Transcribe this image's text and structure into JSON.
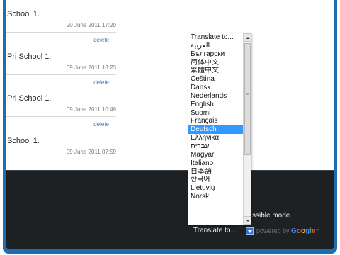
{
  "posts": [
    {
      "title": "School 1.",
      "date": "20 June 2011 17:20",
      "delete_label": "delete"
    },
    {
      "title": "Pri School 1.",
      "date": "09 June 2011 13:23",
      "delete_label": "delete"
    },
    {
      "title": "Pri School 1.",
      "date": "09 June 2011 10:49",
      "delete_label": "delete"
    },
    {
      "title": "School 1.",
      "date": "09 June 2011 07:59"
    }
  ],
  "footer": {
    "mode_text": "ssible mode",
    "translate_select_value": "Translate to...",
    "powered_by_text": "powered by",
    "google_letters": [
      "G",
      "o",
      "o",
      "g",
      "l",
      "e"
    ],
    "trademark": "™"
  },
  "language_dropdown": {
    "options": [
      "Translate to...",
      "العربية",
      "Български",
      "简体中文",
      "繁體中文",
      "Čeština",
      "Dansk",
      "Nederlands",
      "English",
      "Suomi",
      "Français",
      "Deutsch",
      "Ελληνικά",
      "עברית",
      "Magyar",
      "Italiano",
      "日本語",
      "한국어",
      "Lietuvių",
      "Norsk"
    ],
    "selected": "Deutsch"
  },
  "colors": {
    "frame": "#1f6db0",
    "footer_bg": "#1e2124",
    "selection": "#3399ff",
    "link": "#3b7dc4"
  }
}
